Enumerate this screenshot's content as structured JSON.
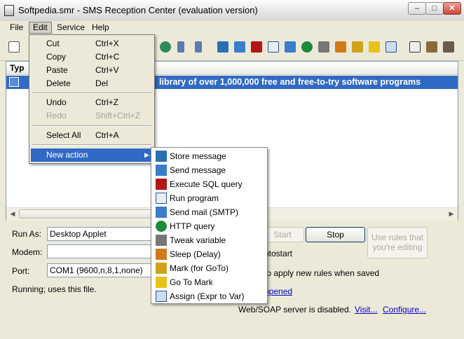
{
  "window": {
    "title": "Softpedia.smr - SMS Reception Center (evaluation version)",
    "minimize_glyph": "–",
    "maximize_glyph": "□",
    "close_glyph": "✕"
  },
  "menubar": {
    "file": "File",
    "edit": "Edit",
    "service": "Service",
    "help": "Help"
  },
  "list": {
    "header": "Typ",
    "row_text": "library of over 1,000,000 free and free-to-try software programs"
  },
  "scroll": {
    "left_arrow": "◀",
    "right_arrow": "▶"
  },
  "form": {
    "run_as_label": "Run As:",
    "run_as_value": "Desktop Applet",
    "modem_label": "Modem:",
    "modem_value": "",
    "port_label": "Port:",
    "port_value": "COM1 (9600,n,8,1,none)",
    "status_text": "Running;  uses this file.",
    "start_label": "Start",
    "stop_label": "Stop",
    "use_rules_line1": "Use rules that",
    "use_rules_line2": "you're editing",
    "autostart_label": "utostart",
    "apply_label": "to apply new rules when saved",
    "happened_link": "ppened",
    "webserver_text": "Web/SOAP server is disabled.",
    "visit_link": "Visit...",
    "configure_link": "Configure..."
  },
  "edit_menu": {
    "items": [
      {
        "label": "Cut",
        "shortcut": "Ctrl+X"
      },
      {
        "label": "Copy",
        "shortcut": "Ctrl+C"
      },
      {
        "label": "Paste",
        "shortcut": "Ctrl+V"
      },
      {
        "label": "Delete",
        "shortcut": "Del"
      },
      {
        "label": "Undo",
        "shortcut": "Ctrl+Z"
      },
      {
        "label": "Redo",
        "shortcut": "Shift+Ctrl+Z"
      },
      {
        "label": "Select All",
        "shortcut": "Ctrl+A"
      },
      {
        "label": "New action",
        "shortcut": "▶"
      }
    ]
  },
  "new_action_menu": {
    "items": [
      {
        "label": "Store message",
        "icon": "store-message-icon",
        "color": "#2a6fb0"
      },
      {
        "label": "Send message",
        "icon": "send-message-icon",
        "color": "#3a7dc9"
      },
      {
        "label": "Execute SQL query",
        "icon": "sql-query-icon",
        "color": "#b01818"
      },
      {
        "label": "Run program",
        "icon": "run-program-icon",
        "color": "#2a4f8f"
      },
      {
        "label": "Send mail (SMTP)",
        "icon": "send-mail-icon",
        "color": "#3a7dc9"
      },
      {
        "label": "HTTP query",
        "icon": "globe-icon",
        "color": "#1f8a3a"
      },
      {
        "label": "Tweak variable",
        "icon": "tweak-icon",
        "color": "#555555"
      },
      {
        "label": "Sleep (Delay)",
        "icon": "sleep-icon",
        "color": "#d07a1a"
      },
      {
        "label": "Mark (for GoTo)",
        "icon": "mark-icon",
        "color": "#d0a21a"
      },
      {
        "label": "Go To Mark",
        "icon": "goto-arrow-icon",
        "color": "#e8c21a"
      },
      {
        "label": "Assign (Expr to Var)",
        "icon": "assign-icon",
        "color": "#2a6fb0"
      }
    ]
  }
}
